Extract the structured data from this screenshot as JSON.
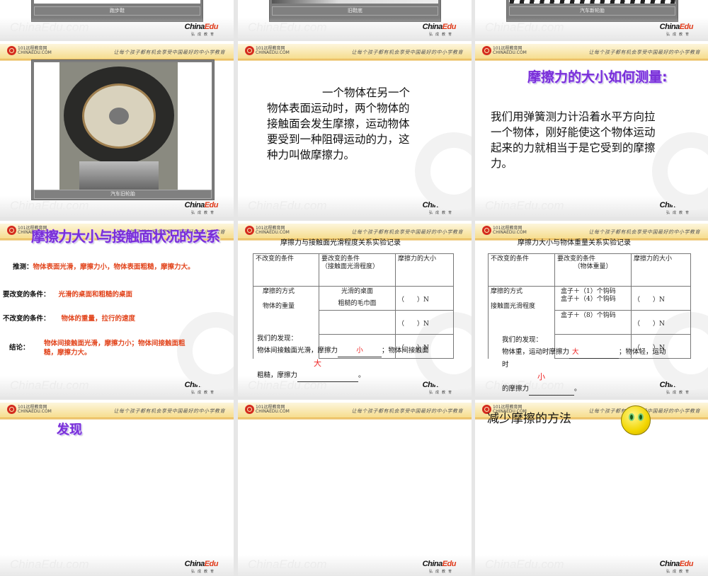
{
  "common": {
    "logo_cn": "101远程教育网",
    "logo_en": "CHINAEDU.COM",
    "slogan": "让每个孩子都有机会享受中国最好的中小学教育",
    "watermark": "ChinaEdu.com",
    "brand_a": "China",
    "brand_b": "Edu",
    "brand_sub": "弘成教育"
  },
  "slides": [
    {
      "caption": "跑步鞋"
    },
    {
      "caption": "旧鞋底"
    },
    {
      "caption": "汽车新轮胎"
    },
    {
      "caption": "汽车旧轮胎"
    },
    {
      "lines": [
        "一个物体在另一个",
        "物体表面运动时，两个物体的",
        "接触面会发生摩擦，运动物体",
        "要受到一种阻碍运动的力，这",
        "种力叫做摩擦力。"
      ]
    },
    {
      "title": "摩擦力的大小如何测量:",
      "lines": [
        "我们用弹簧测力计沿着水平方向拉",
        "一个物体，刚好能使这个物体运动",
        "起来的力就相当于是它受到的摩擦",
        "力。"
      ]
    },
    {
      "title": "摩擦力大小与接触面状况的关系",
      "items": [
        {
          "label": "推测：",
          "value": "物体表面光滑，摩擦力小，物体表面粗糙，摩擦力大。"
        },
        {
          "label": "要改变的条件：",
          "value": "光滑的桌面和粗糙的桌面"
        },
        {
          "label": "不改变的条件：",
          "value": "物体的重量，拉行的速度"
        },
        {
          "label": "结论：",
          "value": "物体间接触面光滑，摩擦力小；物体间接触面粗糙，摩擦力大。"
        }
      ]
    },
    {
      "title": "摩擦力与接触面光滑程度关系实验记录",
      "h1": "不改变的条件",
      "h2": "要改变的条件",
      "h2b": "（接触面光滑程度）",
      "h3": "摩擦力的大小",
      "c1a": "摩擦的方式",
      "c1b": "物体的重量",
      "r1": "光滑的桌面",
      "r2": "粗糙的毛巾面",
      "n": "（　　）N",
      "find": "我们的发现：",
      "f1": "物体间接触面光滑，摩擦力",
      "f1end": "；物体间接触面",
      "f2": "粗糙，摩擦力",
      "a1": "小",
      "a2": "大"
    },
    {
      "title": "摩擦力大小与物体重量关系实验记录",
      "h1": "不改变的条件",
      "h2": "要改变的条件",
      "h2b": "（物体重量）",
      "h3": "摩擦力的大小",
      "c1a": "摩擦的方式",
      "c1b": "接触面光滑程度",
      "r1": "盒子＋（1）个钩码",
      "r2": "盒子＋（4）个钩码",
      "r3": "盒子＋（8）个钩码",
      "n": "（　　）N",
      "find": "我们的发现：",
      "f1": "物体重，运动时摩擦力",
      "f1end": "；物体轻，运动时",
      "f2": "的摩擦力",
      "a1": "大",
      "a2": "小"
    },
    {
      "title": "发现"
    },
    {},
    {
      "title": "减少摩擦的方法"
    }
  ]
}
